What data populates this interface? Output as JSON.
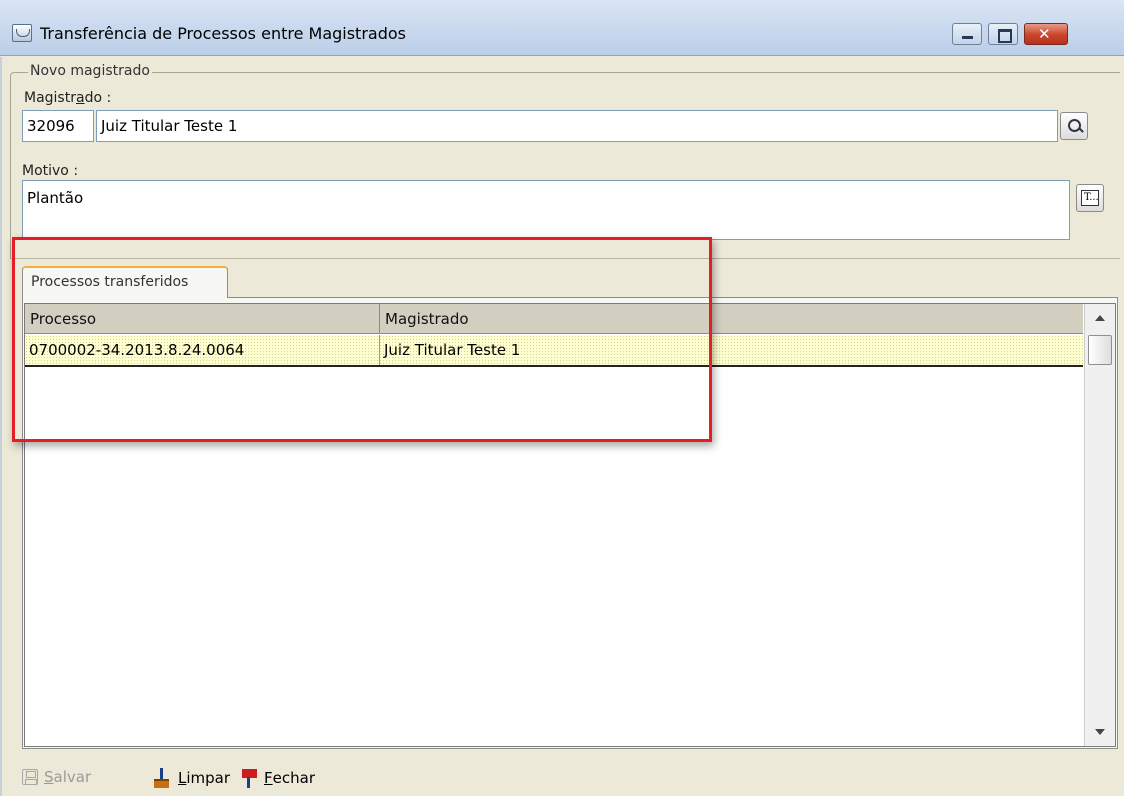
{
  "window": {
    "title": "Transferência de Processos entre Magistrados",
    "icon": "app-icon"
  },
  "group": {
    "legend": "Novo magistrado"
  },
  "magistrado": {
    "label_pre": "Magistr",
    "label_ul": "a",
    "label_post": "do :",
    "code": "32096",
    "name": "Juiz Titular Teste 1",
    "search_icon": "search-icon"
  },
  "motivo": {
    "label": "Motivo :",
    "value": "Plantão",
    "text_editor_icon": "text-editor-icon"
  },
  "tab": {
    "label": "Processos transferidos"
  },
  "grid": {
    "columns": [
      "Processo",
      "Magistrado"
    ],
    "rows": [
      [
        "0700002-34.2013.8.24.0064",
        "Juiz Titular Teste 1"
      ]
    ]
  },
  "toolbar": {
    "salvar": {
      "ul": "S",
      "rest": "alvar",
      "enabled": false,
      "icon": "save-icon"
    },
    "limpar": {
      "ul": "L",
      "rest": "impar",
      "icon": "broom-icon"
    },
    "fechar": {
      "ul": "F",
      "rest": "echar",
      "icon": "flag-icon"
    }
  },
  "colors": {
    "highlight": "#e41e24",
    "selected_row": "#ffffd2",
    "tab_accent": "#f1b23d"
  }
}
